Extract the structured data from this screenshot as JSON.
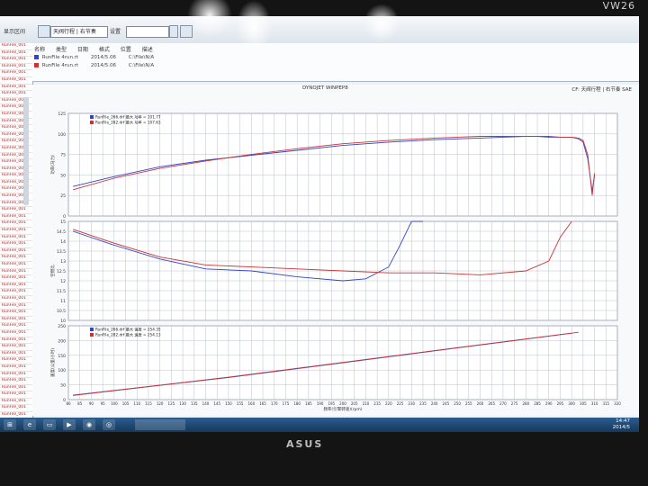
{
  "monitor": {
    "brand_top": "VW26",
    "brand_bottom": "ASUS"
  },
  "toolbar": {
    "left_label": "显示区间",
    "combo1": "天阀行程 | 右节奏",
    "combo2": "",
    "label2": "设置"
  },
  "file_list": {
    "columns": [
      "名称",
      "类型",
      "日期",
      "格式",
      "位置",
      "描述"
    ],
    "rows": [
      {
        "name": "RunFile 4run.rt",
        "date": "2014/5.06",
        "path": "C:\\File\\N/A",
        "color": "#3344cc"
      },
      {
        "name": "RunFile 4run.rt",
        "date": "2014/5.06",
        "path": "C:\\File\\N/A",
        "color": "#cc3333"
      }
    ]
  },
  "left_panel": {
    "item_label": "RunFile_001"
  },
  "chart_header": {
    "title": "DYNOJET WINPEP8",
    "unit": "CF: 天阀行程 | 右节奏 SAE"
  },
  "chart_data": [
    {
      "type": "line",
      "ylabel": "功率(马力)",
      "yticks": [
        0,
        25,
        50,
        75,
        100,
        125
      ],
      "ylim": [
        0,
        125
      ],
      "legend": [
        {
          "name": "RunFile_266.drf 最大 功率 = 101.77",
          "color": "#3344cc"
        },
        {
          "name": "RunFile_282.drf 最大 功率 = 107.63",
          "color": "#cc3333"
        }
      ],
      "series": [
        {
          "name": "run_266",
          "color": "#3344cc",
          "x": [
            82,
            100,
            120,
            140,
            160,
            180,
            200,
            220,
            240,
            260,
            270,
            280,
            285,
            290,
            295,
            300,
            303,
            305,
            307,
            309,
            310
          ],
          "y": [
            36,
            48,
            60,
            68,
            74,
            80,
            86,
            90,
            93,
            95,
            96,
            97,
            97,
            96,
            96,
            96,
            94,
            90,
            70,
            30,
            50
          ]
        },
        {
          "name": "run_282",
          "color": "#cc3333",
          "x": [
            82,
            100,
            120,
            140,
            160,
            180,
            200,
            220,
            240,
            260,
            270,
            280,
            285,
            290,
            295,
            300,
            303,
            305,
            307,
            309,
            310
          ],
          "y": [
            32,
            46,
            58,
            67,
            75,
            82,
            88,
            92,
            95,
            97,
            97,
            97,
            97,
            97,
            96,
            96,
            95,
            92,
            75,
            25,
            52
          ]
        }
      ]
    },
    {
      "type": "line",
      "ylabel": "空燃比",
      "yticks": [
        10,
        10.5,
        11,
        11.5,
        12,
        12.5,
        13,
        13.5,
        14,
        14.5,
        15
      ],
      "ylim": [
        10,
        15
      ],
      "series": [
        {
          "name": "run_266",
          "color": "#3344cc",
          "x": [
            82,
            100,
            120,
            140,
            160,
            180,
            200,
            210,
            220,
            225,
            230,
            235
          ],
          "y": [
            14.5,
            13.8,
            13.1,
            12.6,
            12.5,
            12.2,
            12.0,
            12.1,
            12.7,
            13.8,
            15.2,
            16
          ]
        },
        {
          "name": "run_282",
          "color": "#cc3333",
          "x": [
            82,
            100,
            120,
            140,
            160,
            180,
            200,
            220,
            240,
            260,
            280,
            290,
            295,
            300
          ],
          "y": [
            14.6,
            13.9,
            13.2,
            12.8,
            12.7,
            12.6,
            12.5,
            12.4,
            12.4,
            12.3,
            12.5,
            13.0,
            14.2,
            15.5
          ]
        }
      ]
    },
    {
      "type": "line",
      "ylabel": "速度(公里/小时)",
      "xlabel": "频率(引擎转速)(rpm)",
      "yticks": [
        0,
        50,
        100,
        150,
        200,
        250
      ],
      "ylim": [
        0,
        250
      ],
      "legend": [
        {
          "name": "RunFile_266.drf 最大 速度 = 254.35",
          "color": "#3344cc"
        },
        {
          "name": "RunFile_282.drf 最大 速度 = 254.13",
          "color": "#cc3333"
        }
      ],
      "x_ticks": [
        80,
        85,
        90,
        95,
        100,
        105,
        110,
        115,
        120,
        125,
        130,
        135,
        140,
        145,
        150,
        155,
        160,
        165,
        170,
        175,
        180,
        185,
        190,
        195,
        200,
        205,
        210,
        215,
        220,
        225,
        230,
        235,
        240,
        245,
        250,
        255,
        260,
        265,
        270,
        275,
        280,
        285,
        290,
        295,
        300,
        305,
        310,
        315,
        320
      ],
      "series": [
        {
          "name": "run_266",
          "color": "#3344cc",
          "x": [
            82,
            150,
            200,
            250,
            300
          ],
          "y": [
            15,
            75,
            125,
            175,
            225
          ]
        },
        {
          "name": "run_282",
          "color": "#cc3333",
          "x": [
            82,
            150,
            200,
            250,
            303
          ],
          "y": [
            14,
            76,
            126,
            176,
            228
          ]
        }
      ]
    }
  ],
  "taskbar": {
    "time": "14:47",
    "date": "2014/5"
  }
}
